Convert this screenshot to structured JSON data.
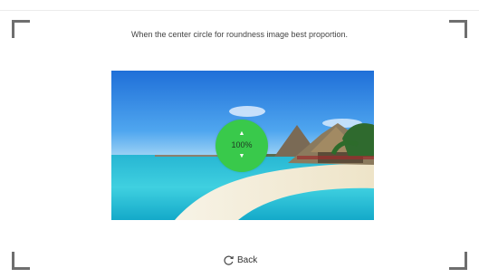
{
  "instruction": "When the center circle for roundness image best proportion.",
  "photo": {
    "subject": "tropical beach with thatched huts"
  },
  "zoom": {
    "value": "100%",
    "up_icon": "triangle-up-icon",
    "down_icon": "triangle-down-icon",
    "color": "#39c94b"
  },
  "back": {
    "label": "Back",
    "icon": "rotate-back-icon"
  }
}
